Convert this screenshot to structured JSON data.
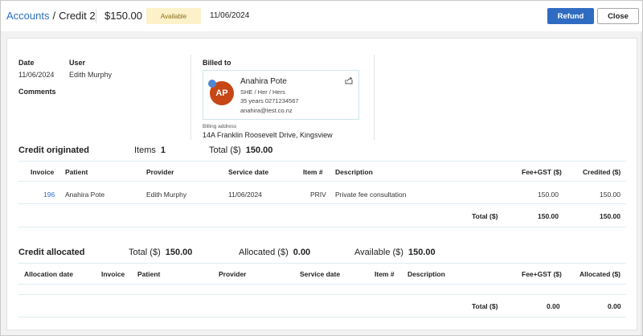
{
  "header": {
    "breadcrumb_link": "Accounts",
    "breadcrumb_sep": "/",
    "breadcrumb_current": "Credit 2",
    "amount": "$150.00",
    "status": "Available",
    "date": "11/06/2024",
    "refund_label": "Refund",
    "close_label": "Close"
  },
  "info": {
    "date_label": "Date",
    "date_value": "11/06/2024",
    "user_label": "User",
    "user_value": "Edith Murphy",
    "comments_label": "Comments",
    "billed_to_label": "Billed to"
  },
  "patient_card": {
    "initials": "AP",
    "name": "Anahira Pote",
    "pronouns": "SHE / Her / Hers",
    "age_phone": "35 years  0271234567",
    "email": "anahira@test.co.nz",
    "billing_address_label": "Billing address",
    "billing_address": "14A Franklin Roosevelt Drive, Kingsview"
  },
  "credit_originated": {
    "title": "Credit originated",
    "items_label": "Items",
    "items_value": "1",
    "total_label": "Total ($)",
    "total_value": "150.00",
    "columns": [
      "Invoice",
      "Patient",
      "Provider",
      "Service date",
      "Item #",
      "Description",
      "Fee+GST ($)",
      "Credited ($)"
    ],
    "rows": [
      {
        "invoice": "196",
        "patient": "Anahira Pote",
        "provider": "Edith Murphy",
        "service_date": "11/06/2024",
        "item": "PRIV",
        "description": "Private fee consultation",
        "fee": "150.00",
        "credited": "150.00"
      }
    ],
    "footer": {
      "label": "Total ($)",
      "fee": "150.00",
      "credited": "150.00"
    }
  },
  "credit_allocated": {
    "title": "Credit allocated",
    "total_label": "Total ($)",
    "total_value": "150.00",
    "allocated_label": "Allocated ($)",
    "allocated_value": "0.00",
    "available_label": "Available ($)",
    "available_value": "150.00",
    "columns": [
      "Allocation date",
      "Invoice",
      "Patient",
      "Provider",
      "Service date",
      "Item #",
      "Description",
      "Fee+GST ($)",
      "Allocated ($)"
    ],
    "footer": {
      "label": "Total ($)",
      "fee": "0.00",
      "allocated": "0.00"
    }
  },
  "colors": {
    "accent": "#2f6cc1",
    "link": "#2a6fbd",
    "badge_bg": "#fcf1c9",
    "avatar": "#c64616"
  },
  "icons": {
    "share": "share-icon"
  }
}
